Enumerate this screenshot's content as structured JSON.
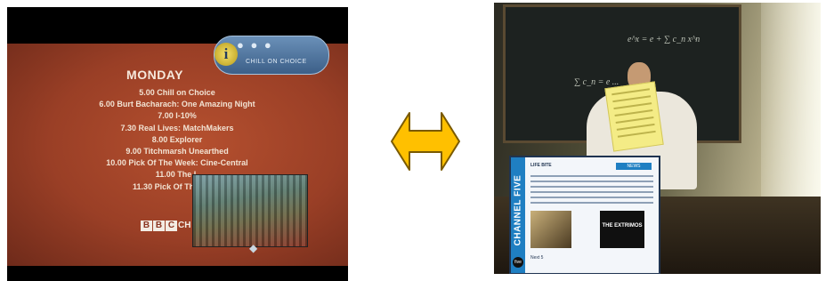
{
  "left_screen": {
    "logo": {
      "icon_letter": "i",
      "dots": "● ● ●",
      "label": "CHILL ON CHOICE"
    },
    "day": "MONDAY",
    "schedule": [
      "5.00  Chill on Choice",
      "6.00 Burt Bacharach: One Amazing Night",
      "7.00  I-10%",
      "7.30 Real Lives: MatchMakers",
      "8.00 Explorer",
      "9.00 Titchmarsh Unearthed",
      "10.00 Pick Of The Week: Cine-Central",
      "11.00  The L",
      "11.30 Pick Of The Week"
    ],
    "channel_logo": {
      "letters": [
        "B",
        "B",
        "C"
      ],
      "suffix": "CH"
    },
    "pip_marker": "◆"
  },
  "arrow": {
    "fill": "#ffc000",
    "stroke": "#7a5a00",
    "direction": "bidirectional"
  },
  "right_screen": {
    "teletext": {
      "side_label": "CHANNEL FIVE",
      "header": "LIFE BITE",
      "tag": "NEWS",
      "thumb2_title": "THE EXTRIMOS",
      "footer": "Next 5",
      "badge": "five"
    },
    "chalk": [
      "e^x = e + ∑ c_n x^n",
      "∑ c_n = e ..."
    ]
  }
}
